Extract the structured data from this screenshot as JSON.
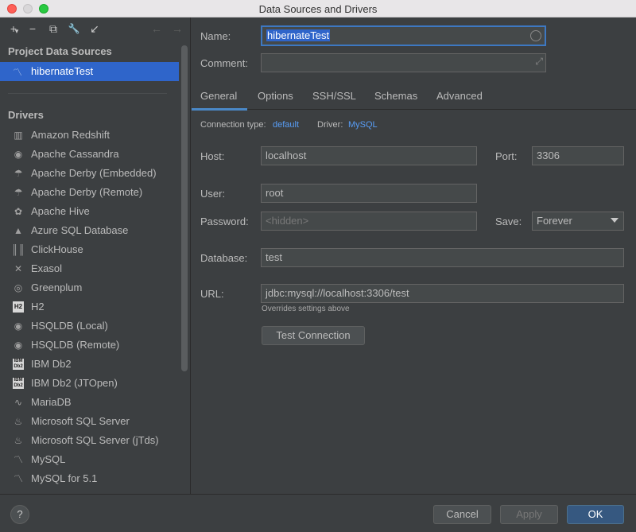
{
  "window": {
    "title": "Data Sources and Drivers"
  },
  "toolbar": {
    "add": "+",
    "add_caret": "▾",
    "remove": "−",
    "copy": "⧉",
    "settings": "🔧",
    "import": "↙",
    "back": "←",
    "forward": "→"
  },
  "left": {
    "project_title": "Project Data Sources",
    "selected_source": "hibernateTest",
    "drivers_title": "Drivers",
    "drivers": [
      {
        "label": "Amazon Redshift",
        "icon": "▥"
      },
      {
        "label": "Apache Cassandra",
        "icon": "◉"
      },
      {
        "label": "Apache Derby (Embedded)",
        "icon": "☂"
      },
      {
        "label": "Apache Derby (Remote)",
        "icon": "☂"
      },
      {
        "label": "Apache Hive",
        "icon": "✿"
      },
      {
        "label": "Azure SQL Database",
        "icon": "▲"
      },
      {
        "label": "ClickHouse",
        "icon": "║║"
      },
      {
        "label": "Exasol",
        "icon": "✕"
      },
      {
        "label": "Greenplum",
        "icon": "◎"
      },
      {
        "label": "H2",
        "icon": "H2"
      },
      {
        "label": "HSQLDB (Local)",
        "icon": "◉"
      },
      {
        "label": "HSQLDB (Remote)",
        "icon": "◉"
      },
      {
        "label": "IBM Db2",
        "icon": "IBM Db2"
      },
      {
        "label": "IBM Db2 (JTOpen)",
        "icon": "IBM Db2"
      },
      {
        "label": "MariaDB",
        "icon": "∿"
      },
      {
        "label": "Microsoft SQL Server",
        "icon": "♨"
      },
      {
        "label": "Microsoft SQL Server (jTds)",
        "icon": "♨"
      },
      {
        "label": "MySQL",
        "icon": "〽"
      },
      {
        "label": "MySQL for 5.1",
        "icon": "〽"
      }
    ]
  },
  "form": {
    "name_label": "Name:",
    "name_value": "hibernateTest",
    "comment_label": "Comment:",
    "comment_value": "",
    "tabs": [
      "General",
      "Options",
      "SSH/SSL",
      "Schemas",
      "Advanced"
    ],
    "connection_type_label": "Connection type:",
    "connection_type_value": "default",
    "driver_label": "Driver:",
    "driver_value": "MySQL",
    "host_label": "Host:",
    "host_value": "localhost",
    "port_label": "Port:",
    "port_value": "3306",
    "user_label": "User:",
    "user_value": "root",
    "password_label": "Password:",
    "password_placeholder": "<hidden>",
    "save_label": "Save:",
    "save_value": "Forever",
    "database_label": "Database:",
    "database_value": "test",
    "url_label": "URL:",
    "url_value": "jdbc:mysql://localhost:3306/test",
    "url_hint": "Overrides settings above",
    "test_connection": "Test Connection"
  },
  "footer": {
    "help": "?",
    "cancel": "Cancel",
    "apply": "Apply",
    "ok": "OK"
  }
}
